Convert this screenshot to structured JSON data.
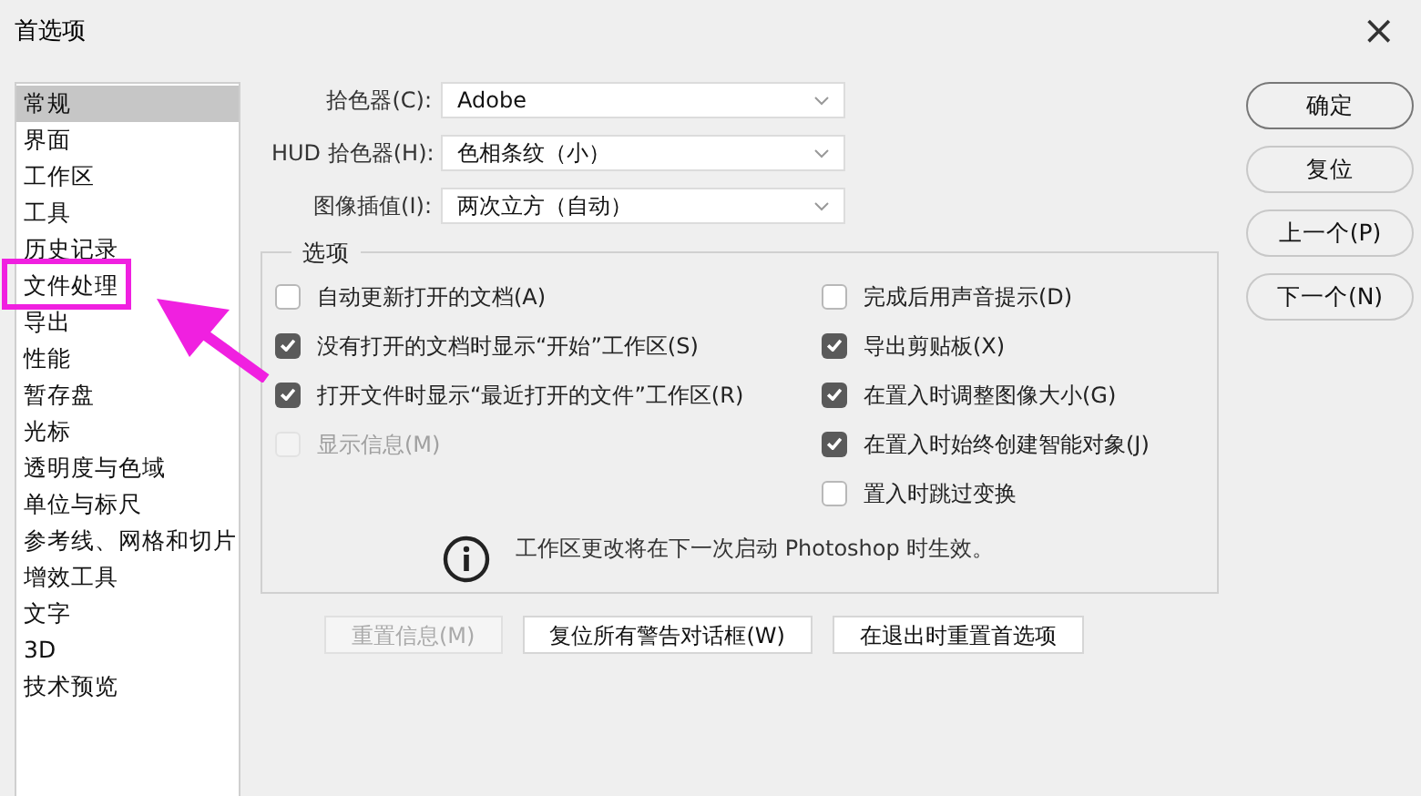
{
  "window": {
    "title": "首选项",
    "close": "×"
  },
  "sidebar": {
    "items": [
      {
        "label": "常规",
        "selected": true,
        "highlighted": false
      },
      {
        "label": "界面",
        "selected": false,
        "highlighted": false
      },
      {
        "label": "工作区",
        "selected": false,
        "highlighted": false
      },
      {
        "label": "工具",
        "selected": false,
        "highlighted": false
      },
      {
        "label": "历史记录",
        "selected": false,
        "highlighted": false
      },
      {
        "label": "文件处理",
        "selected": false,
        "highlighted": true
      },
      {
        "label": "导出",
        "selected": false,
        "highlighted": false
      },
      {
        "label": "性能",
        "selected": false,
        "highlighted": false
      },
      {
        "label": "暂存盘",
        "selected": false,
        "highlighted": false
      },
      {
        "label": "光标",
        "selected": false,
        "highlighted": false
      },
      {
        "label": "透明度与色域",
        "selected": false,
        "highlighted": false
      },
      {
        "label": "单位与标尺",
        "selected": false,
        "highlighted": false
      },
      {
        "label": "参考线、网格和切片",
        "selected": false,
        "highlighted": false
      },
      {
        "label": "增效工具",
        "selected": false,
        "highlighted": false
      },
      {
        "label": "文字",
        "selected": false,
        "highlighted": false
      },
      {
        "label": "3D",
        "selected": false,
        "highlighted": false
      },
      {
        "label": "技术预览",
        "selected": false,
        "highlighted": false
      }
    ]
  },
  "fields": [
    {
      "label": "拾色器(C):",
      "value": "Adobe"
    },
    {
      "label": "HUD 拾色器(H):",
      "value": "色相条纹（小）"
    },
    {
      "label": "图像插值(I):",
      "value": "两次立方（自动）"
    }
  ],
  "options": {
    "title": "选项",
    "left": [
      {
        "label": "自动更新打开的文档(A)",
        "checked": false,
        "disabled": false
      },
      {
        "label": "没有打开的文档时显示“开始”工作区(S)",
        "checked": true,
        "disabled": false
      },
      {
        "label": "打开文件时显示“最近打开的文件”工作区(R)",
        "checked": true,
        "disabled": false
      },
      {
        "label": "显示信息(M)",
        "checked": false,
        "disabled": true
      }
    ],
    "right": [
      {
        "label": "完成后用声音提示(D)",
        "checked": false,
        "disabled": false
      },
      {
        "label": "导出剪贴板(X)",
        "checked": true,
        "disabled": false
      },
      {
        "label": "在置入时调整图像大小(G)",
        "checked": true,
        "disabled": false
      },
      {
        "label": "在置入时始终创建智能对象(J)",
        "checked": true,
        "disabled": false
      },
      {
        "label": "置入时跳过变换",
        "checked": false,
        "disabled": false
      }
    ],
    "info": "工作区更改将在下一次启动 Photoshop 时生效。"
  },
  "bottom_buttons": [
    {
      "label": "重置信息(M)",
      "disabled": true
    },
    {
      "label": "复位所有警告对话框(W)",
      "disabled": false
    },
    {
      "label": "在退出时重置首选项",
      "disabled": false
    }
  ],
  "side_buttons": [
    {
      "label": "确定",
      "default": true
    },
    {
      "label": "复位",
      "default": false
    },
    {
      "label": "上一个(P)",
      "default": false
    },
    {
      "label": "下一个(N)",
      "default": false
    }
  ]
}
